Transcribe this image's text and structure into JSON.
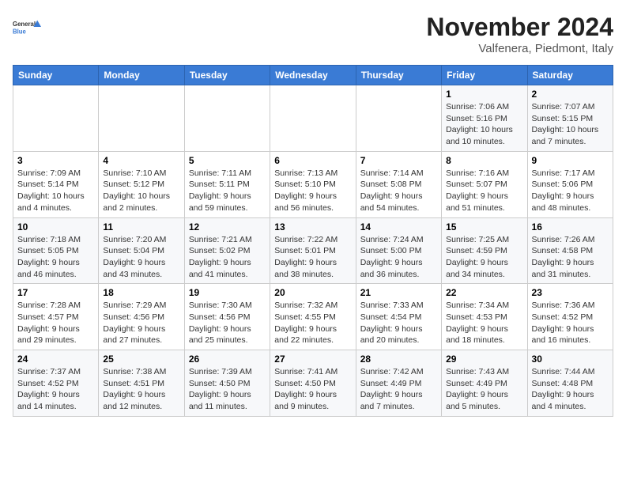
{
  "logo": {
    "general": "General",
    "blue": "Blue"
  },
  "header": {
    "month": "November 2024",
    "location": "Valfenera, Piedmont, Italy"
  },
  "weekdays": [
    "Sunday",
    "Monday",
    "Tuesday",
    "Wednesday",
    "Thursday",
    "Friday",
    "Saturday"
  ],
  "weeks": [
    [
      {
        "day": "",
        "detail": ""
      },
      {
        "day": "",
        "detail": ""
      },
      {
        "day": "",
        "detail": ""
      },
      {
        "day": "",
        "detail": ""
      },
      {
        "day": "",
        "detail": ""
      },
      {
        "day": "1",
        "detail": "Sunrise: 7:06 AM\nSunset: 5:16 PM\nDaylight: 10 hours and 10 minutes."
      },
      {
        "day": "2",
        "detail": "Sunrise: 7:07 AM\nSunset: 5:15 PM\nDaylight: 10 hours and 7 minutes."
      }
    ],
    [
      {
        "day": "3",
        "detail": "Sunrise: 7:09 AM\nSunset: 5:14 PM\nDaylight: 10 hours and 4 minutes."
      },
      {
        "day": "4",
        "detail": "Sunrise: 7:10 AM\nSunset: 5:12 PM\nDaylight: 10 hours and 2 minutes."
      },
      {
        "day": "5",
        "detail": "Sunrise: 7:11 AM\nSunset: 5:11 PM\nDaylight: 9 hours and 59 minutes."
      },
      {
        "day": "6",
        "detail": "Sunrise: 7:13 AM\nSunset: 5:10 PM\nDaylight: 9 hours and 56 minutes."
      },
      {
        "day": "7",
        "detail": "Sunrise: 7:14 AM\nSunset: 5:08 PM\nDaylight: 9 hours and 54 minutes."
      },
      {
        "day": "8",
        "detail": "Sunrise: 7:16 AM\nSunset: 5:07 PM\nDaylight: 9 hours and 51 minutes."
      },
      {
        "day": "9",
        "detail": "Sunrise: 7:17 AM\nSunset: 5:06 PM\nDaylight: 9 hours and 48 minutes."
      }
    ],
    [
      {
        "day": "10",
        "detail": "Sunrise: 7:18 AM\nSunset: 5:05 PM\nDaylight: 9 hours and 46 minutes."
      },
      {
        "day": "11",
        "detail": "Sunrise: 7:20 AM\nSunset: 5:04 PM\nDaylight: 9 hours and 43 minutes."
      },
      {
        "day": "12",
        "detail": "Sunrise: 7:21 AM\nSunset: 5:02 PM\nDaylight: 9 hours and 41 minutes."
      },
      {
        "day": "13",
        "detail": "Sunrise: 7:22 AM\nSunset: 5:01 PM\nDaylight: 9 hours and 38 minutes."
      },
      {
        "day": "14",
        "detail": "Sunrise: 7:24 AM\nSunset: 5:00 PM\nDaylight: 9 hours and 36 minutes."
      },
      {
        "day": "15",
        "detail": "Sunrise: 7:25 AM\nSunset: 4:59 PM\nDaylight: 9 hours and 34 minutes."
      },
      {
        "day": "16",
        "detail": "Sunrise: 7:26 AM\nSunset: 4:58 PM\nDaylight: 9 hours and 31 minutes."
      }
    ],
    [
      {
        "day": "17",
        "detail": "Sunrise: 7:28 AM\nSunset: 4:57 PM\nDaylight: 9 hours and 29 minutes."
      },
      {
        "day": "18",
        "detail": "Sunrise: 7:29 AM\nSunset: 4:56 PM\nDaylight: 9 hours and 27 minutes."
      },
      {
        "day": "19",
        "detail": "Sunrise: 7:30 AM\nSunset: 4:56 PM\nDaylight: 9 hours and 25 minutes."
      },
      {
        "day": "20",
        "detail": "Sunrise: 7:32 AM\nSunset: 4:55 PM\nDaylight: 9 hours and 22 minutes."
      },
      {
        "day": "21",
        "detail": "Sunrise: 7:33 AM\nSunset: 4:54 PM\nDaylight: 9 hours and 20 minutes."
      },
      {
        "day": "22",
        "detail": "Sunrise: 7:34 AM\nSunset: 4:53 PM\nDaylight: 9 hours and 18 minutes."
      },
      {
        "day": "23",
        "detail": "Sunrise: 7:36 AM\nSunset: 4:52 PM\nDaylight: 9 hours and 16 minutes."
      }
    ],
    [
      {
        "day": "24",
        "detail": "Sunrise: 7:37 AM\nSunset: 4:52 PM\nDaylight: 9 hours and 14 minutes."
      },
      {
        "day": "25",
        "detail": "Sunrise: 7:38 AM\nSunset: 4:51 PM\nDaylight: 9 hours and 12 minutes."
      },
      {
        "day": "26",
        "detail": "Sunrise: 7:39 AM\nSunset: 4:50 PM\nDaylight: 9 hours and 11 minutes."
      },
      {
        "day": "27",
        "detail": "Sunrise: 7:41 AM\nSunset: 4:50 PM\nDaylight: 9 hours and 9 minutes."
      },
      {
        "day": "28",
        "detail": "Sunrise: 7:42 AM\nSunset: 4:49 PM\nDaylight: 9 hours and 7 minutes."
      },
      {
        "day": "29",
        "detail": "Sunrise: 7:43 AM\nSunset: 4:49 PM\nDaylight: 9 hours and 5 minutes."
      },
      {
        "day": "30",
        "detail": "Sunrise: 7:44 AM\nSunset: 4:48 PM\nDaylight: 9 hours and 4 minutes."
      }
    ]
  ]
}
